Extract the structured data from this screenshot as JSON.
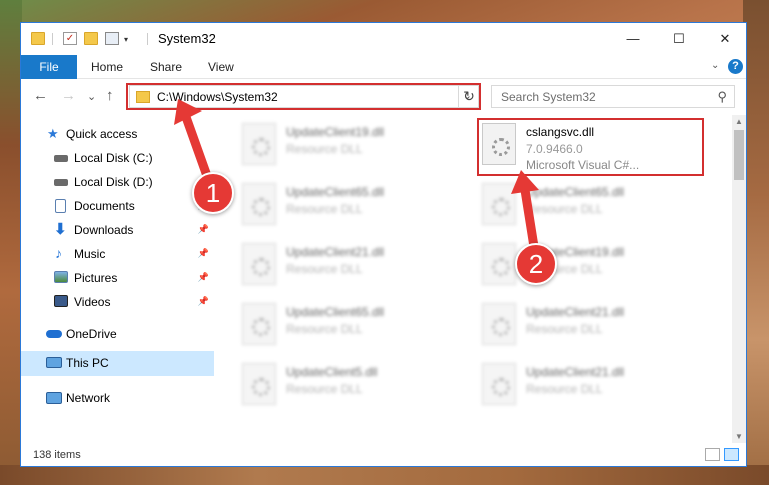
{
  "window": {
    "title": "System32",
    "minimize": "—",
    "maximize": "☐",
    "close": "✕"
  },
  "ribbon": {
    "tabs": [
      "File",
      "Home",
      "Share",
      "View"
    ],
    "expand_glyph": "⌄",
    "help_glyph": "?"
  },
  "navigation": {
    "back": "←",
    "forward": "→",
    "recent": "⌄",
    "up": "↑",
    "address": "C:\\Windows\\System32",
    "address_chevron": "⌄",
    "refresh": "↻",
    "search_placeholder": "Search System32",
    "search_glyph": "⚲"
  },
  "sidebar": {
    "items": [
      {
        "label": "Quick access",
        "icon": "star-icon",
        "pinned": false
      },
      {
        "label": "Local Disk (C:)",
        "icon": "drive-icon",
        "pinned": false
      },
      {
        "label": "Local Disk (D:)",
        "icon": "drive-icon",
        "pinned": false
      },
      {
        "label": "Documents",
        "icon": "documents-icon",
        "pinned": true
      },
      {
        "label": "Downloads",
        "icon": "download-icon",
        "pinned": true
      },
      {
        "label": "Music",
        "icon": "music-icon",
        "pinned": true
      },
      {
        "label": "Pictures",
        "icon": "pictures-icon",
        "pinned": true
      },
      {
        "label": "Videos",
        "icon": "videos-icon",
        "pinned": true
      },
      {
        "label": "OneDrive",
        "icon": "cloud-icon",
        "pinned": false
      },
      {
        "label": "This PC",
        "icon": "computer-icon",
        "pinned": false,
        "selected": true
      },
      {
        "label": "Network",
        "icon": "network-icon",
        "pinned": false
      }
    ],
    "pin_glyph": "📌"
  },
  "files": {
    "left_column": [
      {
        "name": "UpdateClient19.dll",
        "type": "Resource DLL"
      },
      {
        "name": "UpdateClient65.dll",
        "type": "Resource DLL"
      },
      {
        "name": "UpdateClient21.dll",
        "type": "Resource DLL"
      },
      {
        "name": "UpdateClient65.dll",
        "type": "Resource DLL"
      },
      {
        "name": "UpdateClient5.dll",
        "type": "Resource DLL"
      }
    ],
    "highlighted": {
      "name": "cslangsvc.dll",
      "version": "7.0.9466.0",
      "description": "Microsoft Visual C#..."
    },
    "right_column": [
      {
        "name": "UpdateClient65.dll",
        "type": "Resource DLL"
      },
      {
        "name": "UpdateClient19.dll",
        "type": "Resource DLL"
      },
      {
        "name": "UpdateClient21.dll",
        "type": "Resource DLL"
      },
      {
        "name": "UpdateClient21.dll",
        "type": "Resource DLL"
      }
    ]
  },
  "status": {
    "item_count": "138 items"
  },
  "annotations": {
    "step1": "1",
    "step2": "2",
    "highlight_color": "#d32f2f",
    "badge_color": "#e53935"
  },
  "colors": {
    "accent": "#1979ca",
    "selection": "#cce8ff"
  }
}
